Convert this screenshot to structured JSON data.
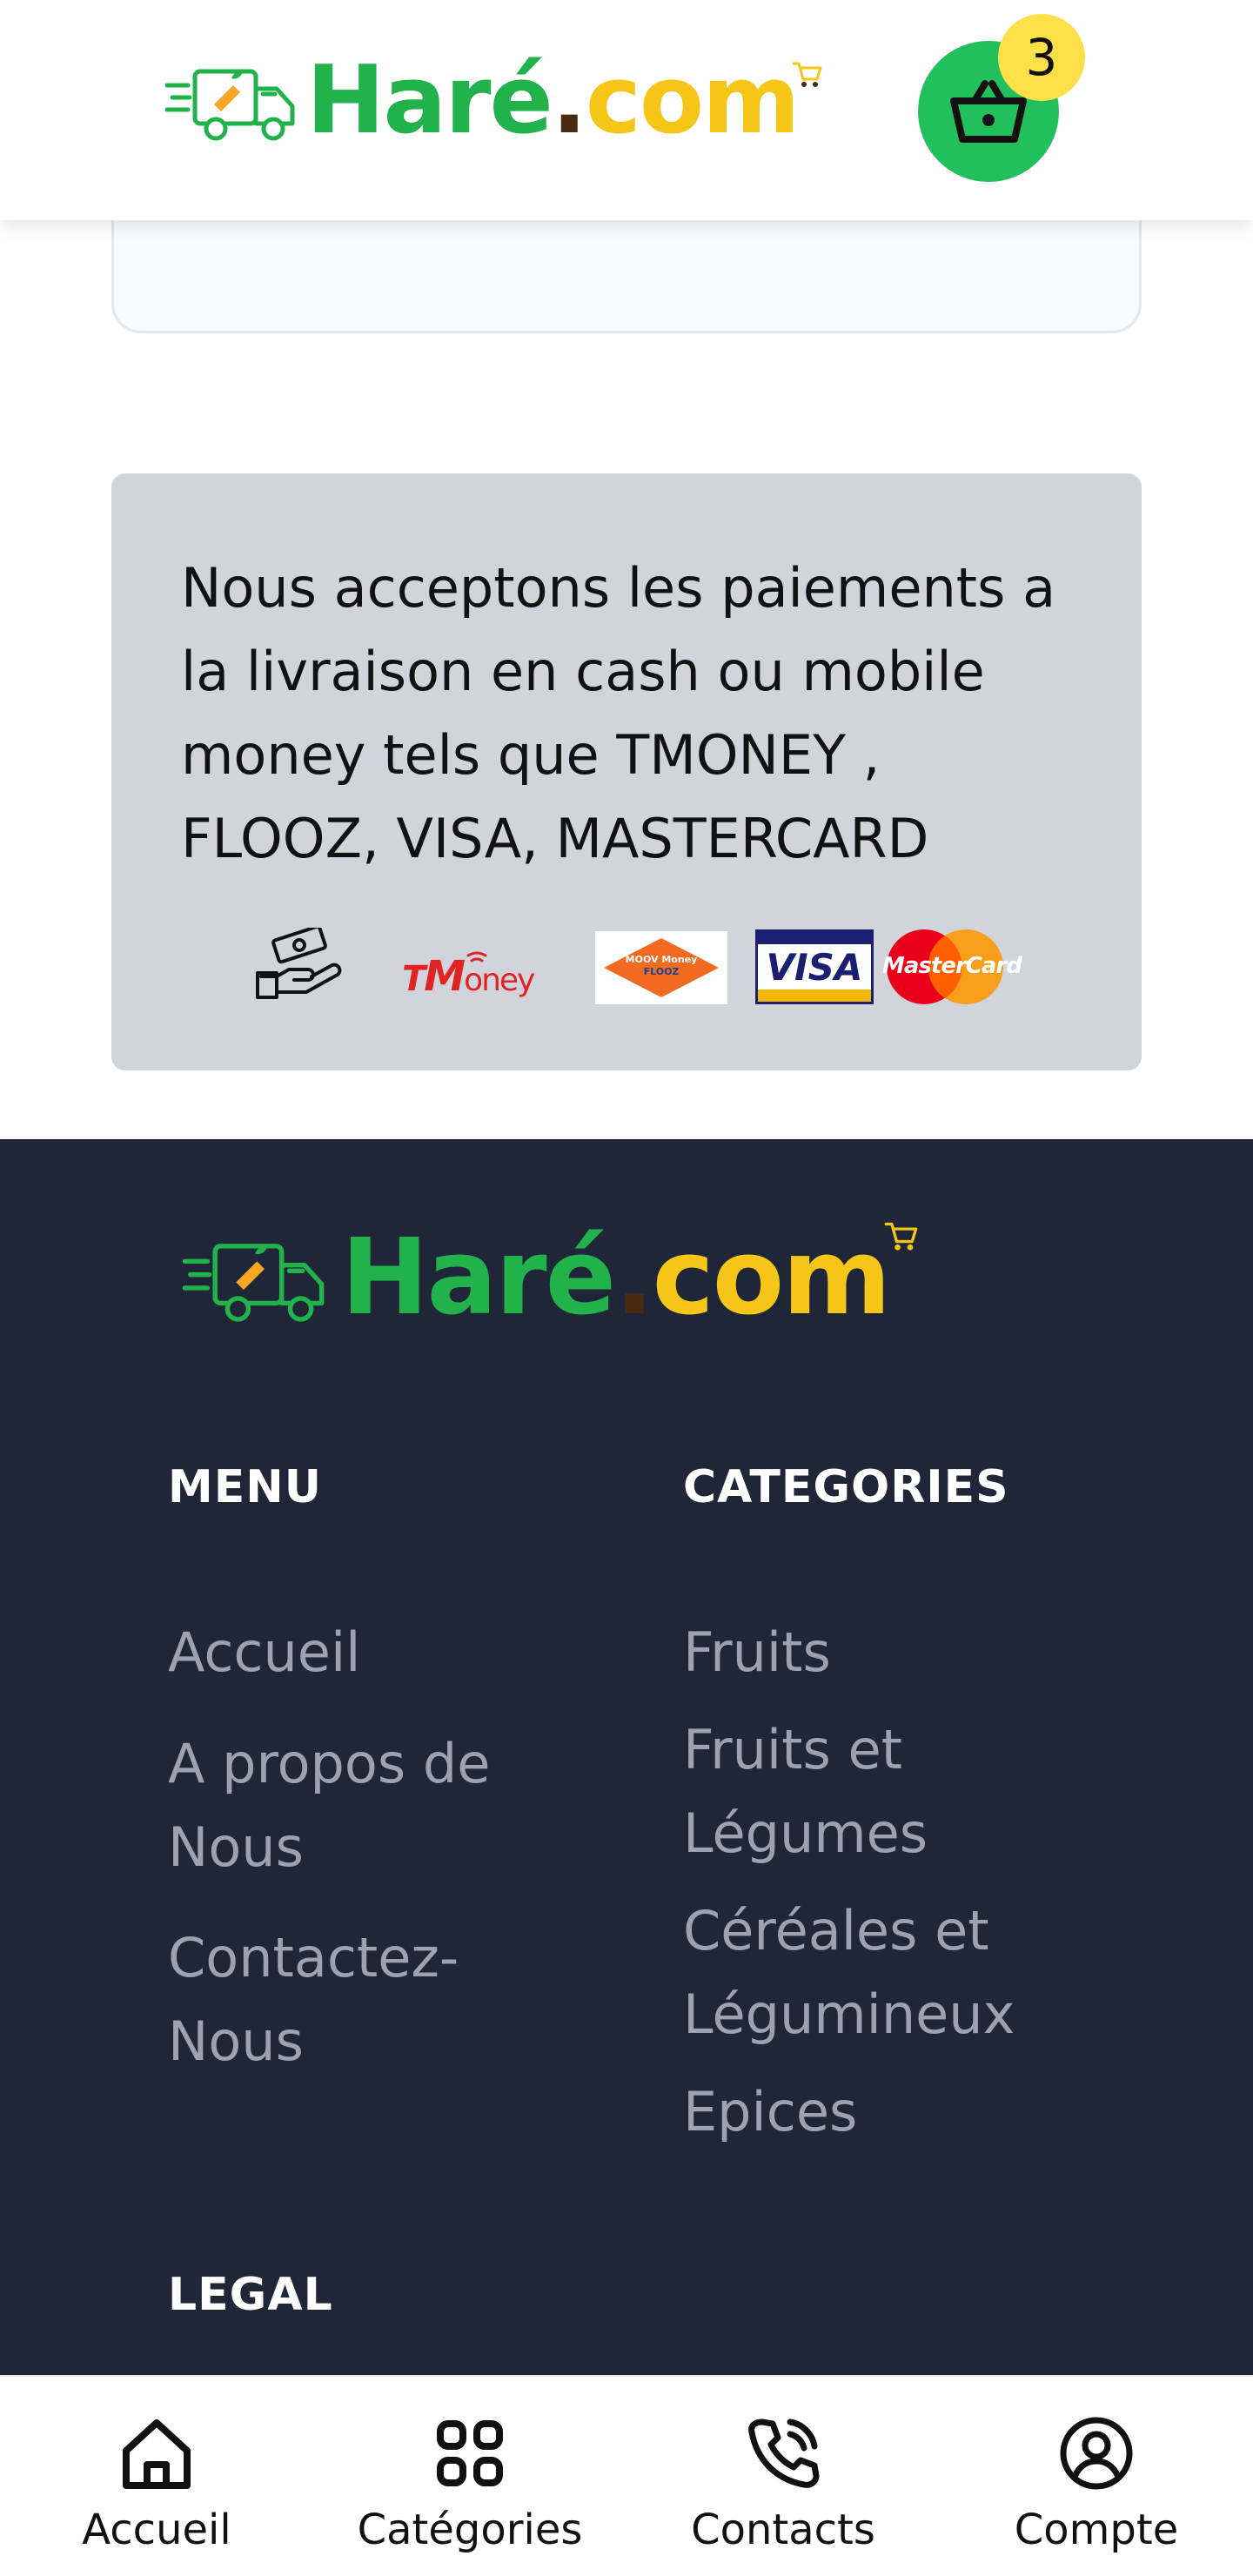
{
  "header": {
    "logo": {
      "hare": "Haré",
      "dot": ".",
      "com": "com"
    },
    "cart_count": "3",
    "cart_icon": "shopping-basket-icon"
  },
  "payment": {
    "text": "Nous acceptons les paiements a la livraison en cash ou mobile money tels que TMONEY , FLOOZ, VISA, MASTERCARD",
    "methods": {
      "cash_icon": "cash-hand-icon",
      "tmoney": {
        "t": "T",
        "rest": "oney"
      },
      "flooz": {
        "line1": "MOOV Money",
        "line2": "FLOOZ"
      },
      "visa": "VISA",
      "mastercard": "MasterCard"
    }
  },
  "footer": {
    "logo": {
      "hare": "Haré",
      "dot": ".",
      "com": "com"
    },
    "menu": {
      "title": "MENU",
      "items": [
        "Accueil",
        "A propos de Nous",
        "Contactez-Nous"
      ]
    },
    "categories": {
      "title": "CATEGORIES",
      "items": [
        "Fruits",
        "Fruits et Légumes",
        "Céréales et Légumineux",
        "Epices"
      ]
    },
    "legal": {
      "title": "LEGAL"
    }
  },
  "bottom_nav": [
    {
      "label": "Accueil",
      "icon": "home-icon"
    },
    {
      "label": "Catégories",
      "icon": "grid-icon"
    },
    {
      "label": "Contacts",
      "icon": "phone-call-icon"
    },
    {
      "label": "Compte",
      "icon": "user-circle-icon"
    }
  ],
  "colors": {
    "brand_green": "#22b24c",
    "brand_yellow": "#f5c518",
    "footer_bg": "#1f2637",
    "cart_green": "#22c05c",
    "badge_yellow": "#fde047"
  }
}
